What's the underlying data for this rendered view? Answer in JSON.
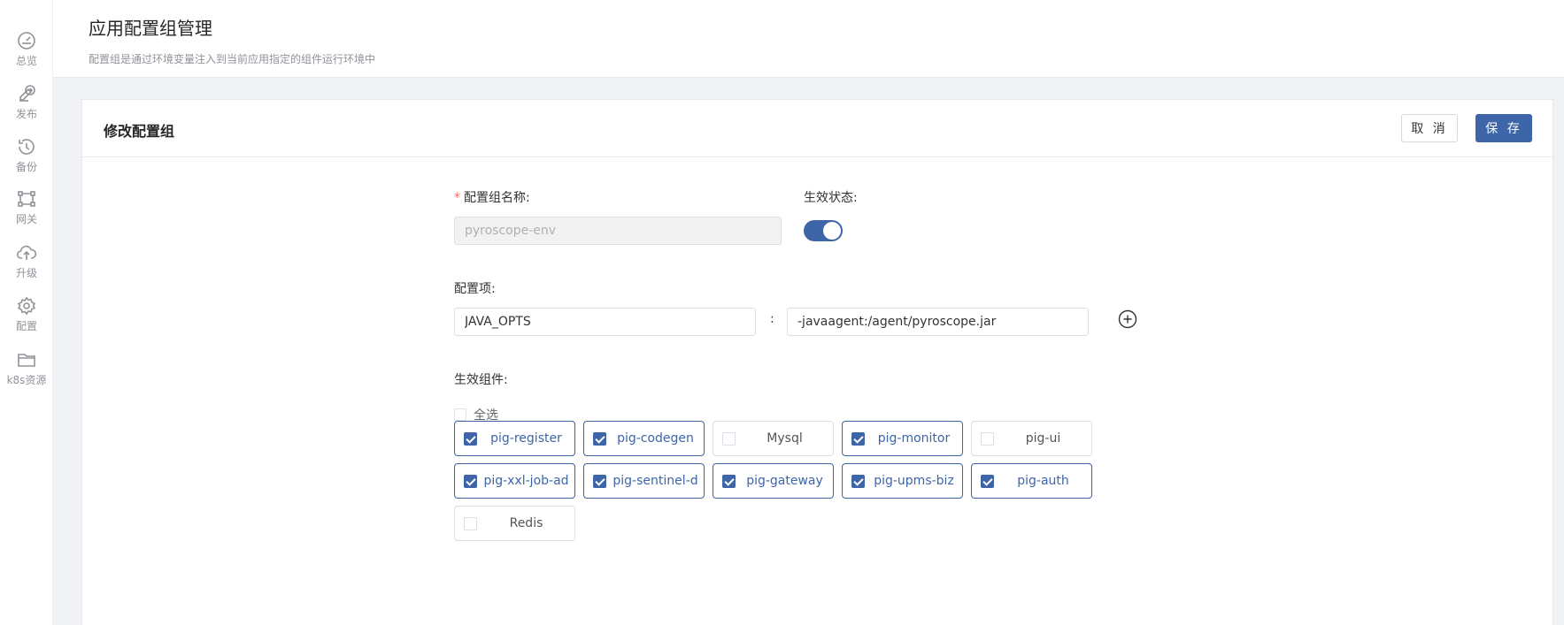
{
  "sidebar": {
    "items": [
      {
        "label": "总览",
        "icon": "gauge-icon"
      },
      {
        "label": "发布",
        "icon": "publish-icon"
      },
      {
        "label": "备份",
        "icon": "history-icon"
      },
      {
        "label": "网关",
        "icon": "gateway-icon"
      },
      {
        "label": "升级",
        "icon": "cloud-upload-icon"
      },
      {
        "label": "配置",
        "icon": "gear-icon"
      },
      {
        "label": "k8s资源",
        "icon": "folder-icon"
      }
    ]
  },
  "header": {
    "title": "应用配置组管理",
    "subtitle": "配置组是通过环境变量注入到当前应用指定的组件运行环境中"
  },
  "card": {
    "title": "修改配置组",
    "cancel_label": "取 消",
    "save_label": "保 存"
  },
  "form": {
    "name_label": "配置组名称:",
    "name_value": "pyroscope-env",
    "status_label": "生效状态:",
    "status_on": true,
    "items_label": "配置项:",
    "item_key": "JAVA_OPTS",
    "item_separator": ":",
    "item_value": "-javaagent:/agent/pyroscope.jar",
    "components_label": "生效组件:",
    "select_all_label": "全选",
    "components": [
      {
        "name": "pig-register",
        "checked": true
      },
      {
        "name": "pig-codegen",
        "checked": true
      },
      {
        "name": "Mysql",
        "checked": false
      },
      {
        "name": "pig-monitor",
        "checked": true
      },
      {
        "name": "pig-ui",
        "checked": false
      },
      {
        "name": "pig-xxl-job-ad",
        "checked": true
      },
      {
        "name": "pig-sentinel-d",
        "checked": true
      },
      {
        "name": "pig-gateway",
        "checked": true
      },
      {
        "name": "pig-upms-biz",
        "checked": true
      },
      {
        "name": "pig-auth",
        "checked": true
      },
      {
        "name": "Redis",
        "checked": false
      }
    ]
  },
  "colors": {
    "accent": "#3d65a8",
    "required": "#f56c6c"
  }
}
